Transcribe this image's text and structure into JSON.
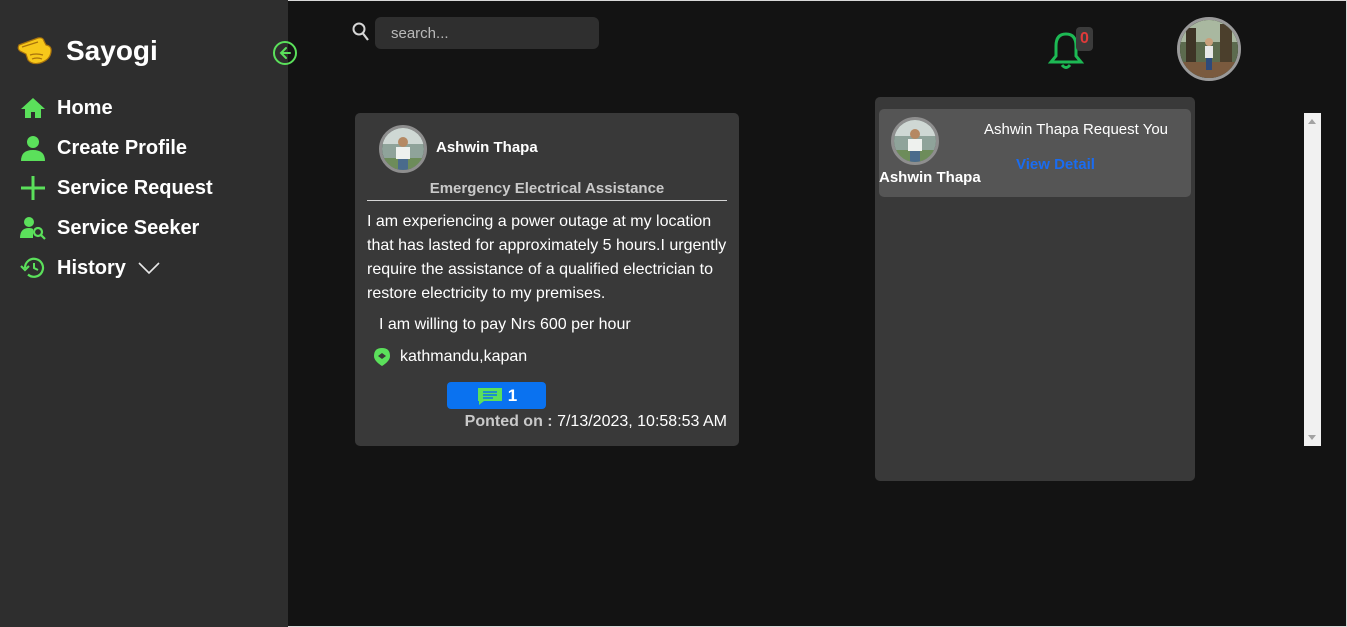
{
  "brand": {
    "name": "Sayogi",
    "logo_icon": "pointing-hand-icon"
  },
  "sidebar": {
    "items": [
      {
        "label": "Home",
        "icon": "home-icon"
      },
      {
        "label": "Create Profile",
        "icon": "person-icon"
      },
      {
        "label": "Service Request",
        "icon": "plus-icon"
      },
      {
        "label": "Service Seeker",
        "icon": "person-search-icon"
      },
      {
        "label": "History",
        "icon": "history-icon"
      }
    ]
  },
  "search": {
    "placeholder": "search..."
  },
  "notifications": {
    "count": "0"
  },
  "post": {
    "author": "Ashwin Thapa",
    "title": "Emergency Electrical Assistance",
    "description": "I am experiencing a power outage at my location that has lasted for approximately 5 hours.I urgently require the assistance of a qualified electrician to restore electricity to my premises.",
    "pay": "I am willing to pay Nrs 600 per hour",
    "location": "kathmandu,kapan",
    "comments": "1",
    "posted_label": "Ponted on :",
    "posted_value": "7/13/2023, 10:58:53 AM"
  },
  "notif_panel": {
    "items": [
      {
        "name": "Ashwin Thapa",
        "message": "Ashwin Thapa Request You",
        "link": "View Detail"
      }
    ]
  },
  "colors": {
    "accent_green": "#5be05b",
    "link_blue": "#1a6cf0",
    "badge_red": "#e03a3a",
    "bell_green": "#1db954"
  }
}
